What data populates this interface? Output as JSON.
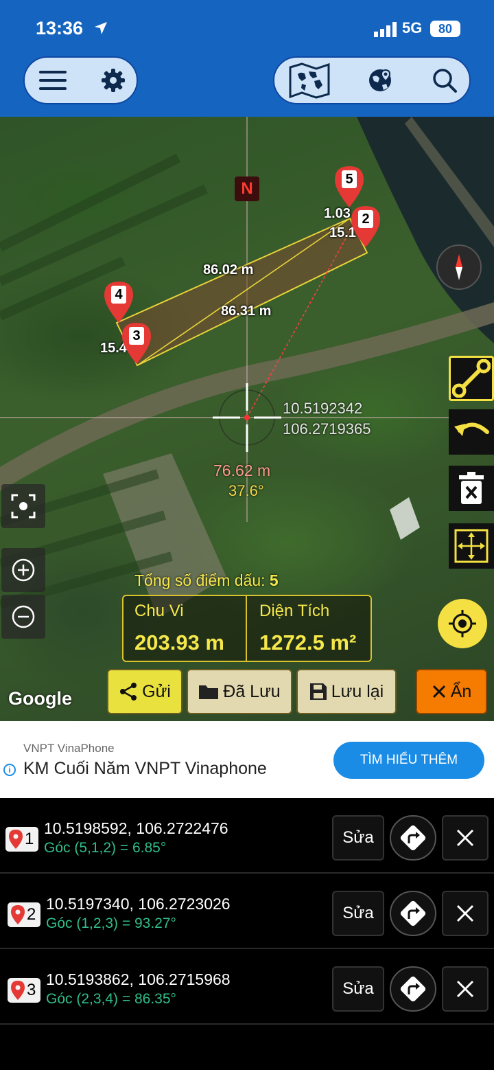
{
  "status": {
    "time": "13:36",
    "network": "5G",
    "battery": "80"
  },
  "map": {
    "north_label": "N",
    "segments": {
      "top": "86.02 m",
      "bottom": "86.31 m",
      "right_a": "1.03",
      "right_b": "15.1",
      "left": "15.4"
    },
    "center": {
      "lat": "10.5192342",
      "lng": "106.2719365",
      "distance": "76.62 m",
      "bearing": "37.6°"
    },
    "markers": [
      "5",
      "2",
      "4",
      "3"
    ],
    "point_count_label": "Tổng số điểm dấu:",
    "point_count": "5",
    "perimeter_label": "Chu Vi",
    "perimeter_value": "203.93 m",
    "area_label": "Diện Tích",
    "area_value": "1272.5 m²",
    "attribution": "Google"
  },
  "actions": {
    "send": "Gửi",
    "saved": "Đã Lưu",
    "save": "Lưu lại",
    "hide": "Ẩn"
  },
  "ad": {
    "advertiser": "VNPT VinaPhone",
    "title": "KM Cuối Năm VNPT Vinaphone",
    "cta": "TÌM HIỂU THÊM"
  },
  "points": [
    {
      "index": "1",
      "coord": "10.5198592, 106.2722476",
      "angle": "Góc (5,1,2) = 6.85°",
      "edit": "Sửa"
    },
    {
      "index": "2",
      "coord": "10.5197340, 106.2723026",
      "angle": "Góc (1,2,3) = 93.27°",
      "edit": "Sửa"
    },
    {
      "index": "3",
      "coord": "10.5193862, 106.2715968",
      "angle": "Góc (2,3,4) = 86.35°",
      "edit": "Sửa"
    }
  ],
  "colors": {
    "accent_blue": "#1565c0",
    "marker_red": "#e53935",
    "highlight_yellow": "#f4e042",
    "angle_green": "#2fbe8a",
    "hide_orange": "#f57c00"
  }
}
